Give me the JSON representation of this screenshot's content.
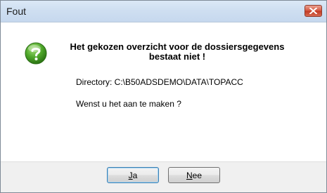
{
  "window": {
    "title": "Fout",
    "close_icon": "close-x-icon"
  },
  "message": {
    "icon": "question-icon",
    "icon_color": "#3f9a1e",
    "heading": "Het gekozen overzicht voor de dossiersgegevens bestaat niet !",
    "directory": "Directory: C:\\B50ADSDEMO\\DATA\\TOPACC",
    "question": "Wenst u het aan te maken ?"
  },
  "buttons": {
    "yes": {
      "mnemonic": "J",
      "rest": "a"
    },
    "no": {
      "mnemonic": "N",
      "rest": "ee"
    }
  },
  "colors": {
    "titlebar": "#cfdff1",
    "close_button": "#c94a33",
    "footer": "#f0f0f0",
    "default_button_border": "#3c7fb1"
  }
}
